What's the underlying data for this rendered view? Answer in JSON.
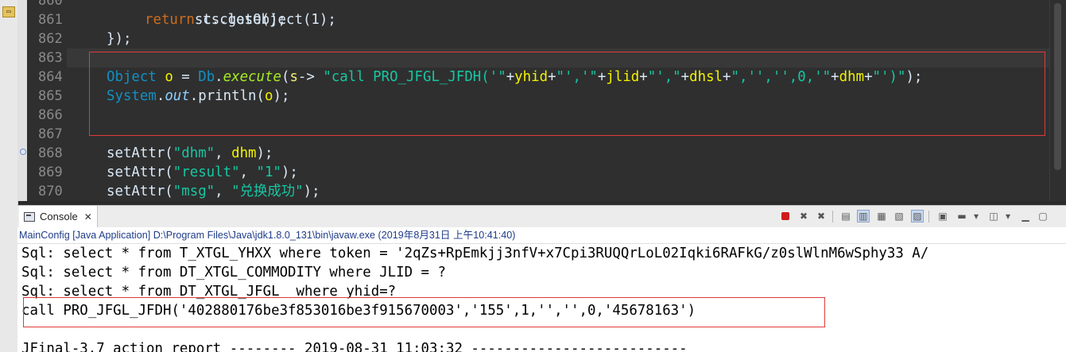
{
  "left_strip": {
    "icon": "folder-icon"
  },
  "editor": {
    "line_numbers": [
      "861",
      "862",
      "863",
      "864",
      "865",
      "866",
      "867",
      "868",
      "869",
      "870"
    ],
    "top_partial": "st.close();",
    "line_861": {
      "kw": "return",
      "rest": " cs.getObject(1);"
    },
    "line_862": "});",
    "line_864": {
      "type": "Object",
      "var": "o",
      "eq": " = ",
      "cls": "Db",
      "dot": ".",
      "method": "execute",
      "open": "(",
      "param": "s",
      "arrow": "-> ",
      "s1": "\"call PRO_JFGL_JFDH('\"",
      "p1": "+",
      "v1": "yhid",
      "p2": "+",
      "s2": "\"','\"",
      "p3": "+",
      "v2": "jlid",
      "p4": "+",
      "s3": "\"',\"",
      "p5": "+",
      "v3": "dhsl",
      "p6": "+",
      "s4": "\",'','',0,'\"",
      "p7": "+",
      "v4": "dhm",
      "p8": "+",
      "s5": "\"')\"",
      "close": ");"
    },
    "line_865": {
      "cls": "System",
      "dot1": ".",
      "field": "out",
      "dot2": ".",
      "method": "println",
      "open": "(",
      "var": "o",
      "close": ");"
    },
    "line_868": {
      "method": "setAttr",
      "open": "(",
      "str": "\"dhm\"",
      "comma": ", ",
      "var": "dhm",
      "close": ");"
    },
    "line_869": {
      "method": "setAttr",
      "open": "(",
      "str1": "\"result\"",
      "comma": ", ",
      "str2": "\"1\"",
      "close": ");"
    },
    "line_870": {
      "method": "setAttr",
      "open": "(",
      "str1": "\"msg\"",
      "comma": ", ",
      "str2": "\"兑换成功\"",
      "close": ");"
    }
  },
  "console": {
    "tab_label": "Console",
    "tab_close": "✕",
    "path": "MainConfig [Java Application] D:\\Program Files\\Java\\jdk1.8.0_131\\bin\\javaw.exe (2019年8月31日 上午10:41:40)",
    "toolbar_icons": [
      "terminate-icon",
      "remove-launch-icon",
      "remove-all-icon",
      "clear-console-icon",
      "scroll-lock-icon",
      "word-wrap-icon",
      "show-on-stdout-icon",
      "show-on-stderr-icon",
      "pin-console-icon",
      "display-console-icon",
      "open-console-icon",
      "minimize-icon",
      "maximize-icon"
    ],
    "output": [
      "Sql: select * from T_XTGL_YHXX where token = '2qZs+RpEmkjj3nfV+x7Cpi3RUQQrLoL02Iqki6RAFkG/z0slWlnM6wSphy33 A/",
      "Sql: select * from DT_XTGL_COMMODITY where JLID = ?",
      "Sql: select * from DT_XTGL_JFGL  where yhid=?",
      "call PRO_JFGL_JFDH('402880176be3f853016be3f915670003','155',1,'','',0,'45678163')",
      "",
      "JFinal-3.7 action report -------- 2019-08-31 11:03:32 --------------------------"
    ]
  }
}
